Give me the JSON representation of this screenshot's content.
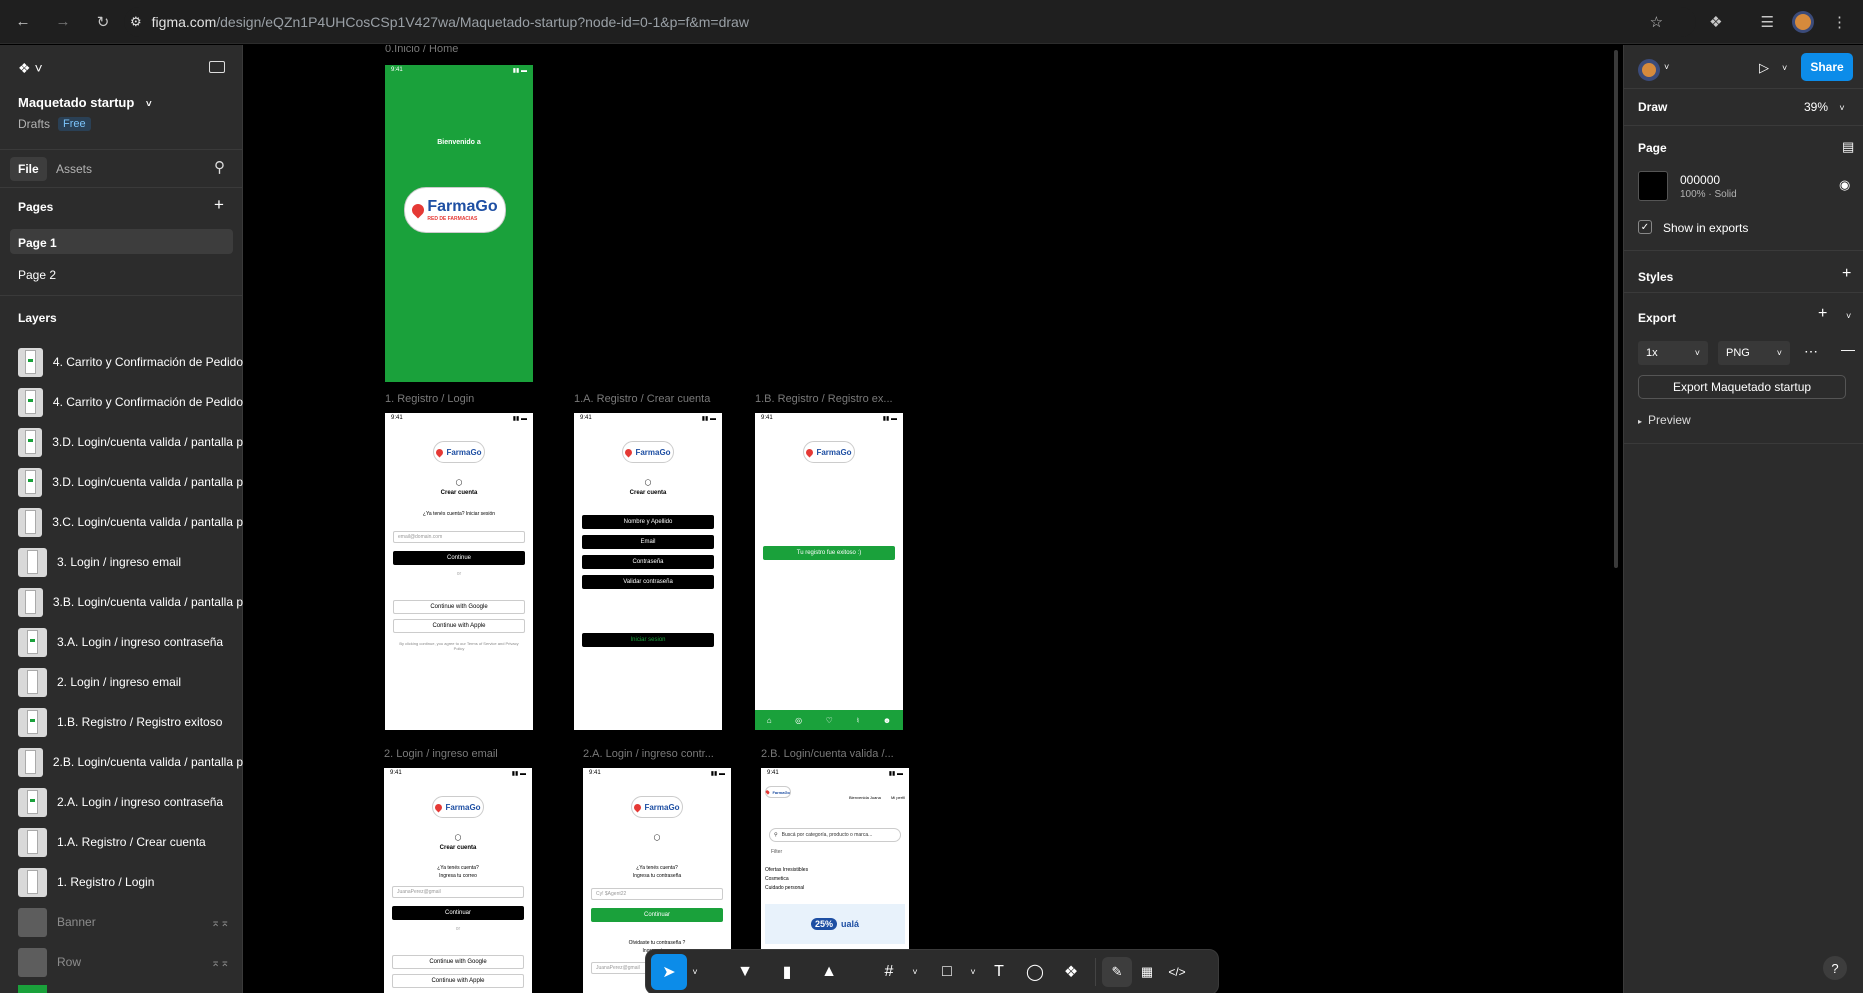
{
  "browser": {
    "url_host": "figma.com",
    "url_path": "/design/eQZn1P4UHCosCSp1V427wa/Maquetado-startup?node-id=0-1&p=f&m=draw"
  },
  "file": {
    "name": "Maquetado startup",
    "location": "Drafts",
    "plan_badge": "Free"
  },
  "left_tabs": {
    "file": "File",
    "assets": "Assets"
  },
  "pages": {
    "heading": "Pages",
    "items": [
      "Page 1",
      "Page 2"
    ]
  },
  "layers": {
    "heading": "Layers",
    "items": [
      "4. Carrito y Confirmación de Pedido",
      "4. Carrito y Confirmación de Pedido",
      "3.D. Login/cuenta valida / pantalla p",
      "3.D. Login/cuenta valida / pantalla p",
      "3.C. Login/cuenta valida / pantalla p",
      "3. Login / ingreso email",
      "3.B. Login/cuenta valida / pantalla p",
      "3.A. Login / ingreso contraseña",
      "2. Login / ingreso email",
      "1.B. Registro / Registro exitoso",
      "2.B. Login/cuenta valida / pantalla p",
      "2.A. Login / ingreso contraseña",
      "1.A. Registro / Crear cuenta",
      "1. Registro / Login",
      "Banner",
      "Row"
    ]
  },
  "canvas": {
    "frame_titles": [
      "0.Inicio / Home",
      "1. Registro / Login",
      "1.A. Registro / Crear cuenta",
      "1.B. Registro / Registro ex...",
      "2. Login / ingreso email",
      "2.A. Login / ingreso contr...",
      "2.B. Login/cuenta valida /..."
    ],
    "phone": {
      "time": "9:41",
      "welcome": "Bienvenido a",
      "logo": "FarmaGo",
      "logo_sub": "RED DE FARMACIAS",
      "crear_cuenta": "Crear cuenta",
      "ya_tenes": "¿Ya tenés cuenta? Iniciar sesión",
      "email_ph": "email@domain.com",
      "continue": "Continue",
      "or": "or",
      "google": "Continue with Google",
      "apple": "Continue with Apple",
      "terms": "By clicking continue, you agree to our Terms of Service and Privacy Policy",
      "nombre": "Nombre y Apellido",
      "email": "Email",
      "contrasena": "Contraseña",
      "validar": "Validar contraseña",
      "iniciar": "Iniciar sesion",
      "registro_ok": "Tu registro fue exitoso :)",
      "ya_tenes2": "¿Ya tenés cuenta?",
      "ingresa_correo": "Ingresa tu correo",
      "juana": "JuanaPerez@gmail",
      "continuar": "Continuar",
      "ingresa_pass": "Ingresa tu contraseña",
      "pass_ph": "Cy! $Agent22",
      "olvidaste": "Olvidaste tu contraseña ?",
      "ingresa_tu": "Ingresa tu co",
      "bienvenida": "Bienvenida Juana",
      "mi_perfil": "Mi perfil",
      "busca": "Buscá por categoría, producto o marca...",
      "filter": "Filter",
      "ofertas": "Ofertas Irresistibles",
      "cosmetica": "Cosmetica",
      "cuidado": "Cuidado personal",
      "promo": "25%",
      "uala": "ualá"
    }
  },
  "right": {
    "mode": "Draw",
    "zoom": "39%",
    "share": "Share",
    "page_heading": "Page",
    "bg_hex": "000000",
    "bg_meta": "100% · Solid",
    "show_exports": "Show in exports",
    "styles": "Styles",
    "export": "Export",
    "scale": "1x",
    "format": "PNG",
    "export_btn": "Export Maquetado startup",
    "preview": "Preview"
  },
  "colors": {
    "accent": "#0d99ff",
    "share": "#0c8ce9",
    "green": "#1aa13b"
  }
}
